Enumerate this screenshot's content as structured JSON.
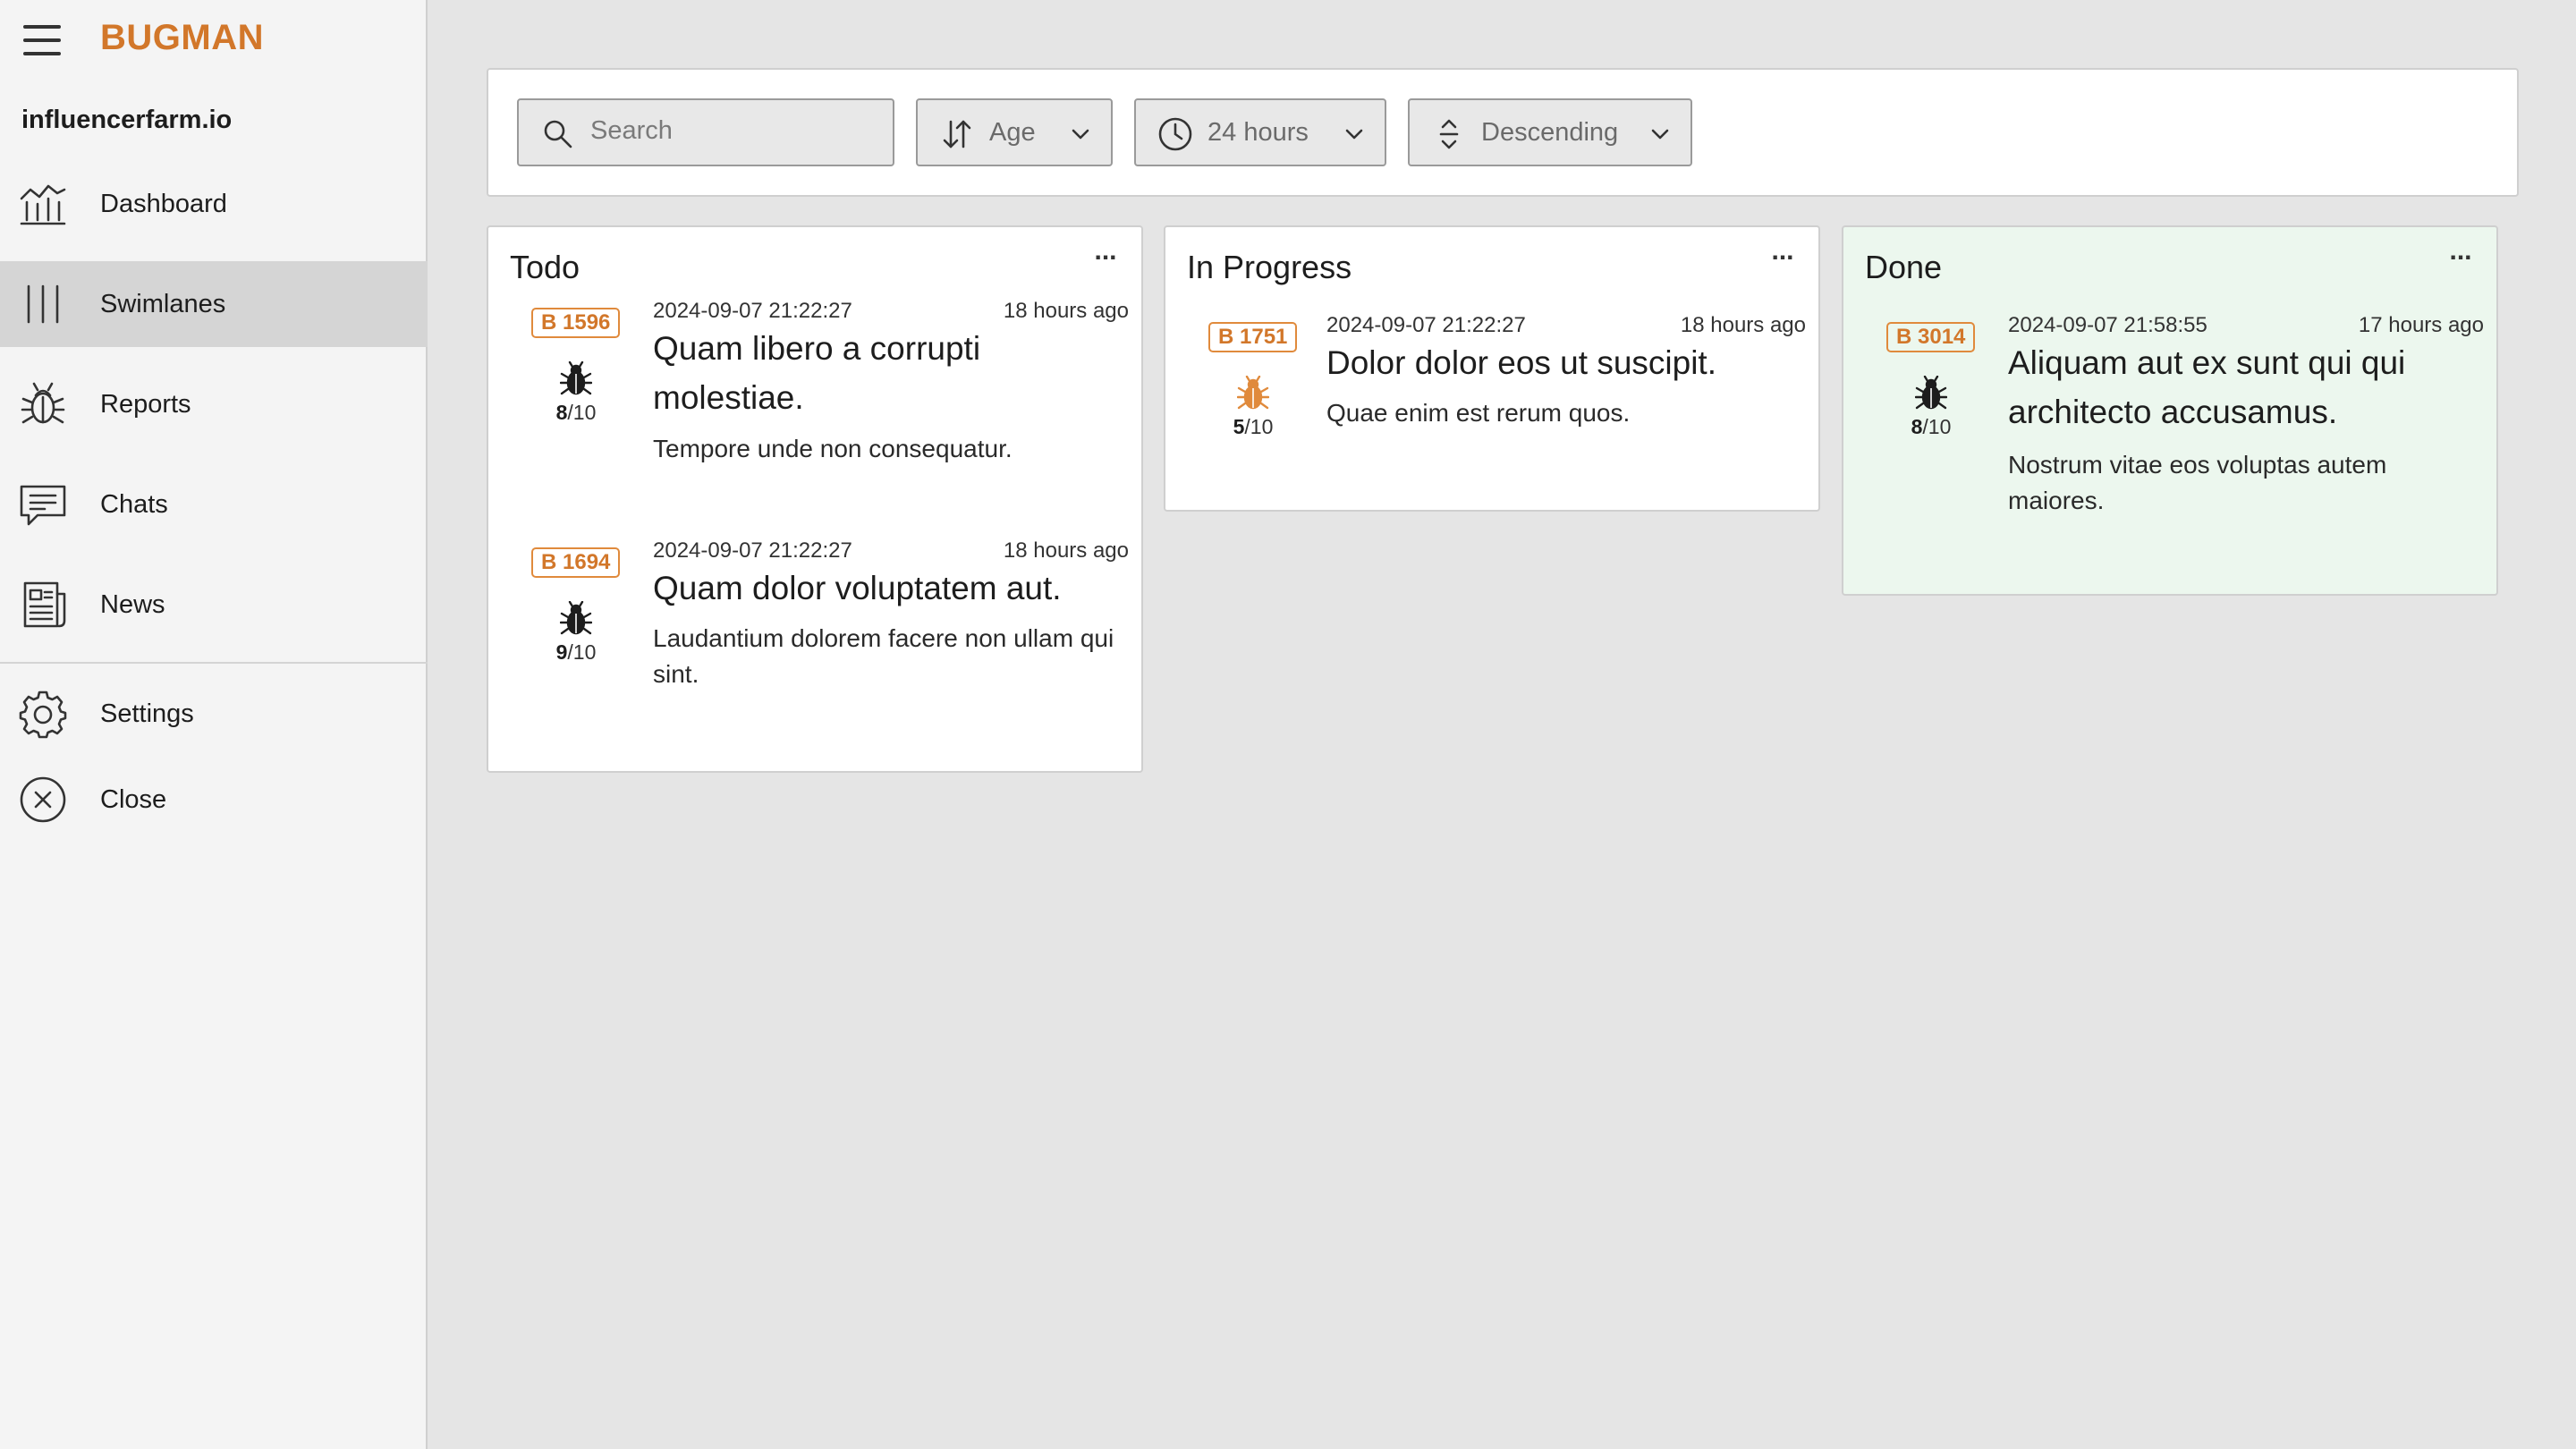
{
  "app": {
    "name": "BUGMAN",
    "org": "influencerfarm.io"
  },
  "sidebar": {
    "items": [
      {
        "label": "Dashboard",
        "icon": "chart-icon"
      },
      {
        "label": "Swimlanes",
        "icon": "swimlanes-icon"
      },
      {
        "label": "Reports",
        "icon": "bug-icon"
      },
      {
        "label": "Chats",
        "icon": "chat-icon"
      },
      {
        "label": "News",
        "icon": "news-icon"
      },
      {
        "label": "Settings",
        "icon": "gear-icon"
      },
      {
        "label": "Close",
        "icon": "close-circle-icon"
      }
    ],
    "active": "Swimlanes"
  },
  "filters": {
    "search_placeholder": "Search",
    "sort_label": "Age",
    "time_label": "24 hours",
    "order_label": "Descending"
  },
  "columns": [
    {
      "title": "Todo",
      "menu": "...",
      "cards": [
        {
          "id": "B 1596",
          "score_value": "8",
          "score_total": "/10",
          "severity": "dark",
          "timestamp": "2024-09-07 21:22:27",
          "age": "18 hours ago",
          "title": "Quam libero a corrupti molestiae.",
          "description": "Tempore unde non consequatur."
        },
        {
          "id": "B 1694",
          "score_value": "9",
          "score_total": "/10",
          "severity": "dark",
          "timestamp": "2024-09-07 21:22:27",
          "age": "18 hours ago",
          "title": "Quam dolor voluptatem aut.",
          "description": "Laudantium dolorem facere non ullam qui sint."
        }
      ]
    },
    {
      "title": "In Progress",
      "menu": "...",
      "cards": [
        {
          "id": "B 1751",
          "score_value": "5",
          "score_total": "/10",
          "severity": "orange",
          "timestamp": "2024-09-07 21:22:27",
          "age": "18 hours ago",
          "title": "Dolor dolor eos ut suscipit.",
          "description": "Quae enim est rerum quos."
        }
      ]
    },
    {
      "title": "Done",
      "menu": "...",
      "cards": [
        {
          "id": "B 3014",
          "score_value": "8",
          "score_total": "/10",
          "severity": "dark",
          "timestamp": "2024-09-07 21:58:55",
          "age": "17 hours ago",
          "title": "Aliquam aut ex sunt qui qui architecto accusamus.",
          "description": "Nostrum vitae eos voluptas autem maiores."
        }
      ]
    }
  ],
  "colors": {
    "brand": "#d2772a",
    "done_column_bg": "#ecf7ee",
    "severity_dark": "#1d1d1d",
    "severity_orange": "#e08a3c"
  }
}
